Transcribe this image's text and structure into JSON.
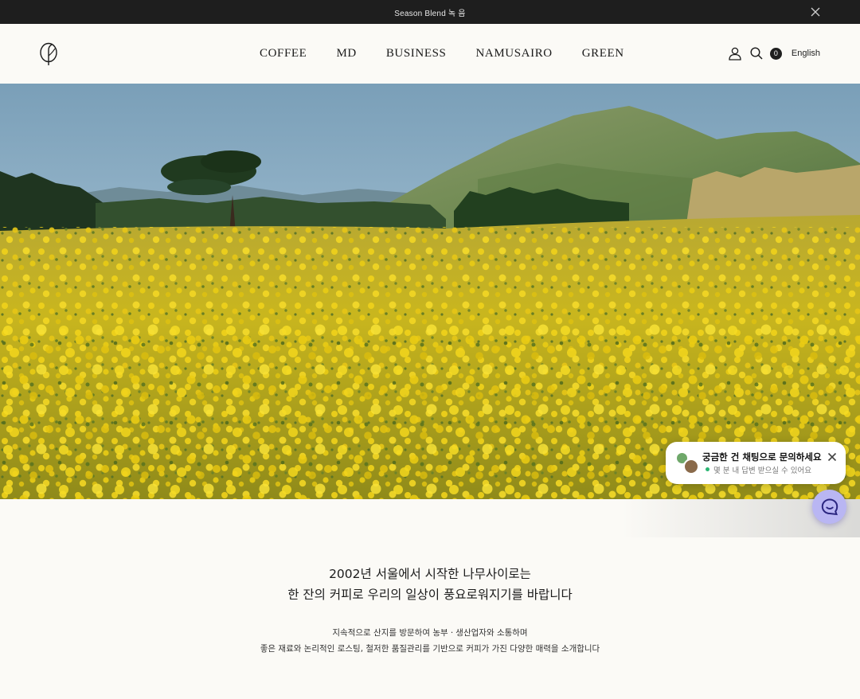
{
  "announcement": {
    "text": "Season Blend 녹 음",
    "close_icon": "close-icon"
  },
  "header": {
    "logo": "leaf-logo",
    "nav": [
      "COFFEE",
      "MD",
      "BUSINESS",
      "NAMUSAIRO",
      "GREEN"
    ],
    "icons": {
      "account": "user-icon",
      "search": "search-icon"
    },
    "cart_count": "0",
    "language": "English"
  },
  "hero": {
    "scene": "rapeseed-field-and-volcanic-hill-photo"
  },
  "chat": {
    "title": "궁금한 건 채팅으로 문의하세요",
    "subtitle": "몇 분 내 답변 받으실 수 있어요",
    "close_icon": "close-icon",
    "launcher_icon": "chat-bubble-icon",
    "status_color": "#2bb673",
    "launcher_color": "#b9b6f3"
  },
  "intro": {
    "headline_1": "2002년 서울에서 시작한 나무사이로는",
    "headline_2": "한 잔의 커피로 우리의 일상이 풍요로워지기를 바랍니다",
    "body_1": "지속적으로 산지를 방문하여 농부ㆍ생산업자와 소통하며",
    "body_2": "좋은 재료와 논리적인 로스팅, 철저한 품질관리를 기반으로 커피가 가진 다양한 매력을 소개합니다"
  }
}
